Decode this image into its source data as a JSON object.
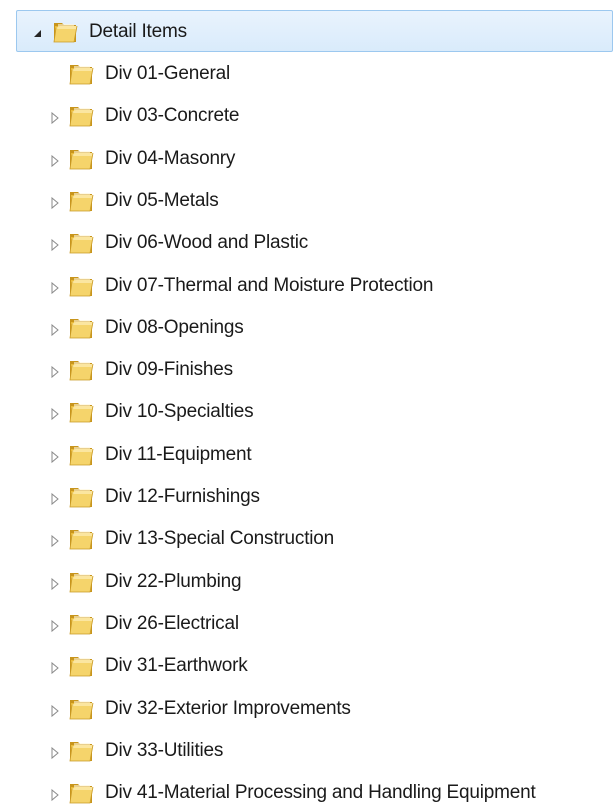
{
  "tree": {
    "root": {
      "label": "Detail Items",
      "expanded": true,
      "selected": true,
      "icon": "folder-icon"
    },
    "children": [
      {
        "label": "Div 01-General",
        "has_children": false
      },
      {
        "label": "Div 03-Concrete",
        "has_children": true
      },
      {
        "label": "Div 04-Masonry",
        "has_children": true
      },
      {
        "label": "Div 05-Metals",
        "has_children": true
      },
      {
        "label": "Div 06-Wood and Plastic",
        "has_children": true
      },
      {
        "label": "Div 07-Thermal and Moisture Protection",
        "has_children": true
      },
      {
        "label": "Div 08-Openings",
        "has_children": true
      },
      {
        "label": "Div 09-Finishes",
        "has_children": true
      },
      {
        "label": "Div 10-Specialties",
        "has_children": true
      },
      {
        "label": "Div 11-Equipment",
        "has_children": true
      },
      {
        "label": "Div 12-Furnishings",
        "has_children": true
      },
      {
        "label": "Div 13-Special Construction",
        "has_children": true
      },
      {
        "label": "Div 22-Plumbing",
        "has_children": true
      },
      {
        "label": "Div 26-Electrical",
        "has_children": true
      },
      {
        "label": "Div 31-Earthwork",
        "has_children": true
      },
      {
        "label": "Div 32-Exterior Improvements",
        "has_children": true
      },
      {
        "label": "Div 33-Utilities",
        "has_children": true
      },
      {
        "label": "Div 41-Material Processing and Handling Equipment",
        "has_children": true
      }
    ]
  },
  "colors": {
    "selection_fill": "#d9ebfb",
    "selection_border": "#9cc8ef",
    "folder_front": "#f3cf5c",
    "folder_back": "#d9a92a",
    "expander": "#8a8a8a"
  }
}
